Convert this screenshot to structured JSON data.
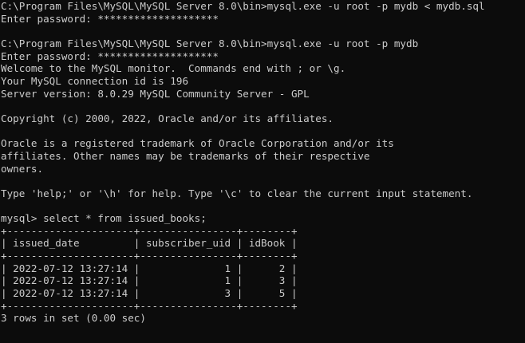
{
  "terminal": {
    "background": "#0c0c0c",
    "foreground": "#cccccc",
    "lines": [
      "C:\\Program Files\\MySQL\\MySQL Server 8.0\\bin>mysql.exe -u root -p mydb < mydb.sql",
      "Enter password: ********************",
      "",
      "C:\\Program Files\\MySQL\\MySQL Server 8.0\\bin>mysql.exe -u root -p mydb",
      "Enter password: ********************",
      "Welcome to the MySQL monitor.  Commands end with ; or \\g.",
      "Your MySQL connection id is 196",
      "Server version: 8.0.29 MySQL Community Server - GPL",
      "",
      "Copyright (c) 2000, 2022, Oracle and/or its affiliates.",
      "",
      "Oracle is a registered trademark of Oracle Corporation and/or its",
      "affiliates. Other names may be trademarks of their respective",
      "owners.",
      "",
      "Type 'help;' or '\\h' for help. Type '\\c' to clear the current input statement.",
      "",
      "mysql> select * from issued_books;",
      "+---------------------+----------------+--------+",
      "| issued_date         | subscriber_uid | idBook |",
      "+---------------------+----------------+--------+",
      "| 2022-07-12 13:27:14 |              1 |      2 |",
      "| 2022-07-12 13:27:14 |              1 |      3 |",
      "| 2022-07-12 13:27:14 |              3 |      5 |",
      "+---------------------+----------------+--------+",
      "3 rows in set (0.00 sec)"
    ]
  }
}
